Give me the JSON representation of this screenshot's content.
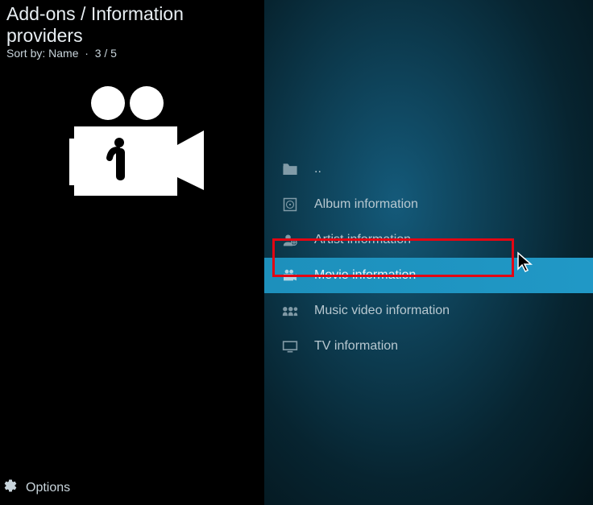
{
  "header": {
    "title": "Add-ons / Information providers",
    "sort_label": "Sort by: Name",
    "position": "3 / 5"
  },
  "options_label": "Options",
  "list": {
    "items": [
      {
        "label": "..",
        "icon": "folder-up-icon"
      },
      {
        "label": "Album information",
        "icon": "album-icon"
      },
      {
        "label": "Artist information",
        "icon": "artist-icon"
      },
      {
        "label": "Movie information",
        "icon": "movie-icon",
        "selected": true
      },
      {
        "label": "Music video information",
        "icon": "music-video-icon"
      },
      {
        "label": "TV information",
        "icon": "tv-icon"
      }
    ]
  }
}
